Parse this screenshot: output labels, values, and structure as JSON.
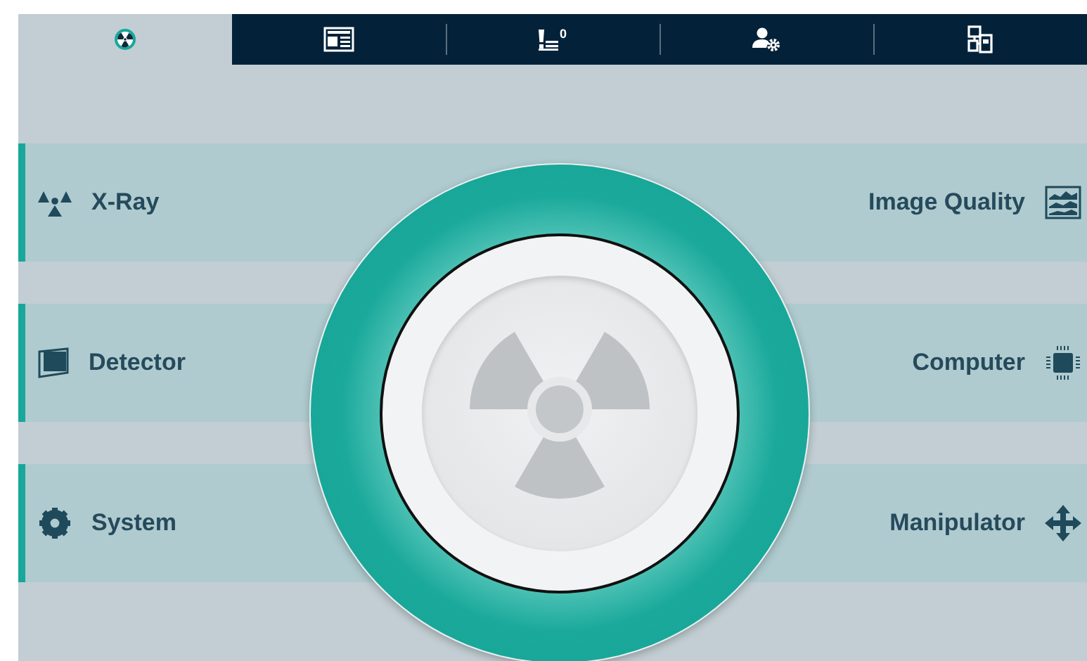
{
  "tabs": [
    {
      "kind": "radiation",
      "selected": true
    },
    {
      "kind": "report",
      "selected": false
    },
    {
      "kind": "alerts",
      "badge": "0",
      "selected": false
    },
    {
      "kind": "user-settings",
      "selected": false
    },
    {
      "kind": "network",
      "selected": false
    }
  ],
  "left_menu": [
    {
      "label": "X-Ray",
      "kind": "radiation"
    },
    {
      "label": "Detector",
      "kind": "detector"
    },
    {
      "label": "System",
      "kind": "gear"
    }
  ],
  "right_menu": [
    {
      "label": "Image Quality",
      "kind": "image-quality"
    },
    {
      "label": "Computer",
      "kind": "chip"
    },
    {
      "label": "Manipulator",
      "kind": "move"
    }
  ]
}
